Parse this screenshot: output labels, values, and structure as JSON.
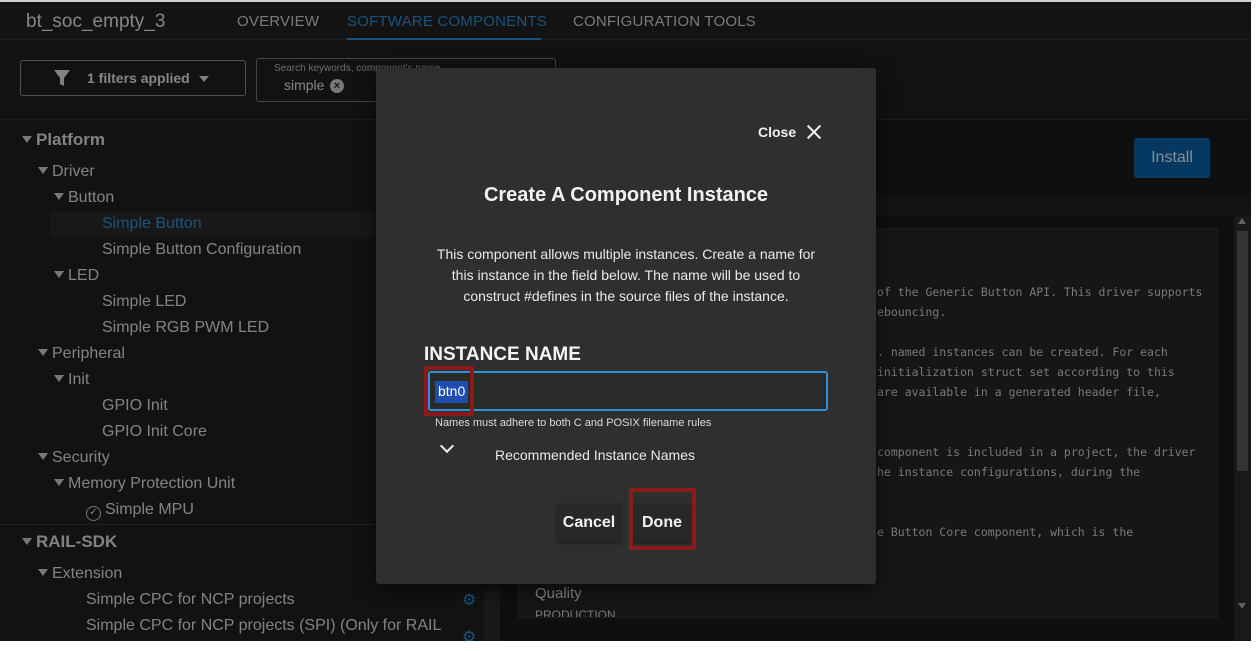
{
  "app": {
    "project_title": "bt_soc_empty_3",
    "tabs": [
      "OVERVIEW",
      "SOFTWARE COMPONENTS",
      "CONFIGURATION TOOLS"
    ],
    "active_tab": "SOFTWARE COMPONENTS",
    "accent_color": "#2d8fd5"
  },
  "filter": {
    "label": "1 filters applied",
    "icon": "filter-icon"
  },
  "search": {
    "placeholder": "Search keywords, component's name",
    "chip": "simple"
  },
  "tree": {
    "platform": "Platform",
    "driver": "Driver",
    "button": "Button",
    "simple_button": "Simple Button",
    "simple_button_config": "Simple Button Configuration",
    "led": "LED",
    "simple_led": "Simple LED",
    "simple_rgb_pwm_led": "Simple RGB PWM LED",
    "peripheral": "Peripheral",
    "init": "Init",
    "gpio_init": "GPIO Init",
    "gpio_init_core": "GPIO Init Core",
    "security": "Security",
    "mpu": "Memory Protection Unit",
    "simple_mpu": "Simple MPU",
    "rail_sdk": "RAIL-SDK",
    "extension": "Extension",
    "cpc_ncp": "Simple CPC for NCP projects",
    "cpc_ncp_spi": "Simple CPC for NCP projects (SPI) (Only for RAIL"
  },
  "details": {
    "install_label": "Install",
    "doc_lines": [
      "of the Generic Button API. This driver supports",
      "ebouncing.",
      "",
      ". named instances can be created. For each",
      "initialization struct set according to this",
      "are available in a generated header file,",
      "",
      "",
      "component is included in a project, the driver",
      "he instance configurations, during the",
      "",
      "",
      "e Button Core component, which is the"
    ],
    "quality_label": "Quality",
    "quality_value": "PRODUCTION"
  },
  "modal": {
    "close_label": "Close",
    "title": "Create A Component Instance",
    "description": "This component allows multiple instances. Create a name for this instance in the field below. The name will be used to construct #defines in the source files of the instance.",
    "instance_label": "INSTANCE NAME",
    "instance_value": "btn0",
    "hint": "Names must adhere to both C and POSIX filename rules",
    "recommended_label": "Recommended Instance Names",
    "cancel_label": "Cancel",
    "done_label": "Done"
  }
}
